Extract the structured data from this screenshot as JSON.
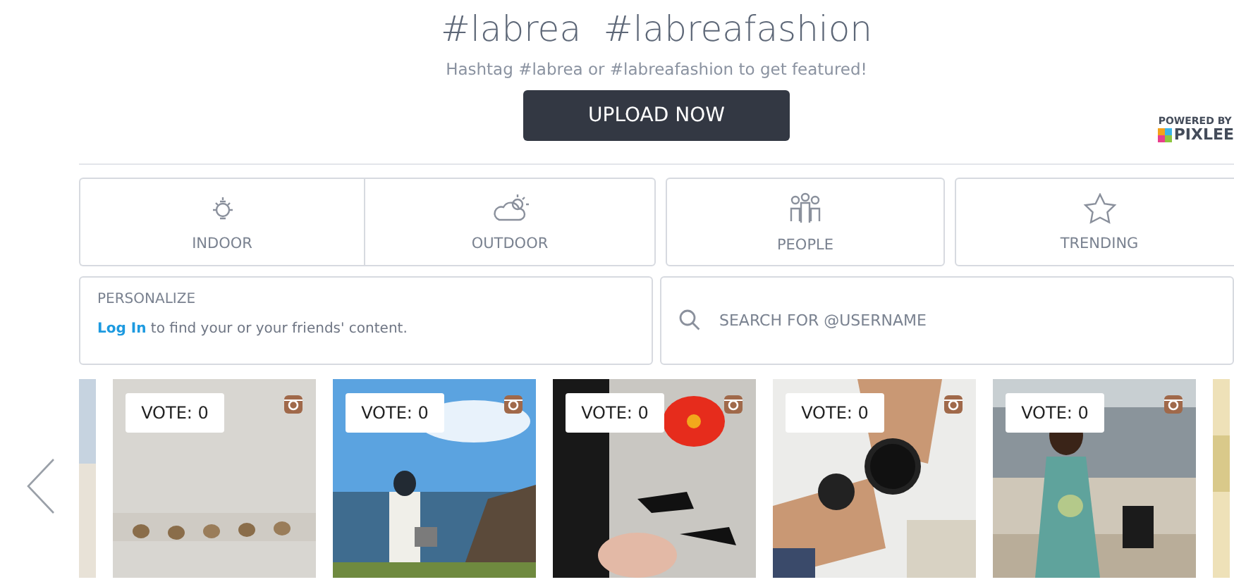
{
  "header": {
    "title": "#labrea  #labreafashion",
    "subtitle": "Hashtag #labrea or #labreafashion to get featured!",
    "upload_button": "UPLOAD NOW",
    "powered_by": "POWERED BY",
    "brand": "PIXLEE"
  },
  "filters": [
    {
      "label": "INDOOR",
      "kind": "bulb"
    },
    {
      "label": "OUTDOOR",
      "kind": "cloud"
    },
    {
      "label": "PEOPLE",
      "kind": "people"
    },
    {
      "label": "TRENDING",
      "kind": "star"
    }
  ],
  "personalize": {
    "heading": "PERSONALIZE",
    "link": "Log In",
    "text": "to find your or your friends' content."
  },
  "search": {
    "placeholder": "SEARCH FOR @USERNAME"
  },
  "photos": [
    {
      "vote": "VOTE: 0"
    },
    {
      "vote": "VOTE: 0"
    },
    {
      "vote": "VOTE: 0"
    },
    {
      "vote": "VOTE: 0"
    },
    {
      "vote": "VOTE: 0"
    }
  ]
}
